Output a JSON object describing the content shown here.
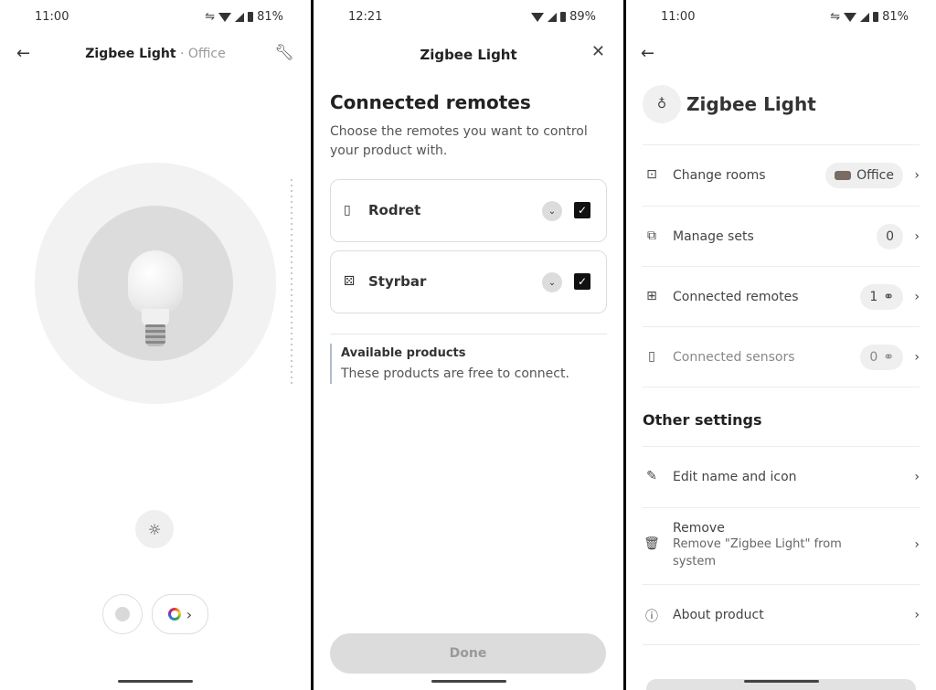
{
  "screen1": {
    "status": {
      "time": "11:00",
      "battery": "81%"
    },
    "title": "Zigbee Light",
    "separator": "·",
    "room": "Office",
    "icons": {
      "back": "back-arrow-icon",
      "settings": "wrench-icon",
      "brightness": "sun-icon",
      "color": "color-wheel-icon"
    }
  },
  "screen2": {
    "status": {
      "time": "12:21",
      "battery": "89%"
    },
    "title": "Zigbee Light",
    "heading": "Connected remotes",
    "description": "Choose the remotes you want to control your product with.",
    "remotes": [
      {
        "name": "Rodret",
        "checked": true
      },
      {
        "name": "Styrbar",
        "checked": true
      }
    ],
    "available_title": "Available products",
    "available_desc": "These products are free to connect.",
    "done_label": "Done"
  },
  "screen3": {
    "status": {
      "time": "11:00",
      "battery": "81%"
    },
    "device_name": "Zigbee Light",
    "rows": {
      "change_rooms": {
        "label": "Change rooms",
        "value": "Office",
        "swatch": "#7a6b63"
      },
      "manage_sets": {
        "label": "Manage sets",
        "value": "0"
      },
      "connected_remotes": {
        "label": "Connected remotes",
        "value": "1"
      },
      "connected_sensors": {
        "label": "Connected sensors",
        "value": "0"
      }
    },
    "other_settings": "Other settings",
    "edit_name": "Edit name and icon",
    "remove_title": "Remove",
    "remove_desc": "Remove \"Zigbee Light\" from system",
    "about": "About product"
  }
}
